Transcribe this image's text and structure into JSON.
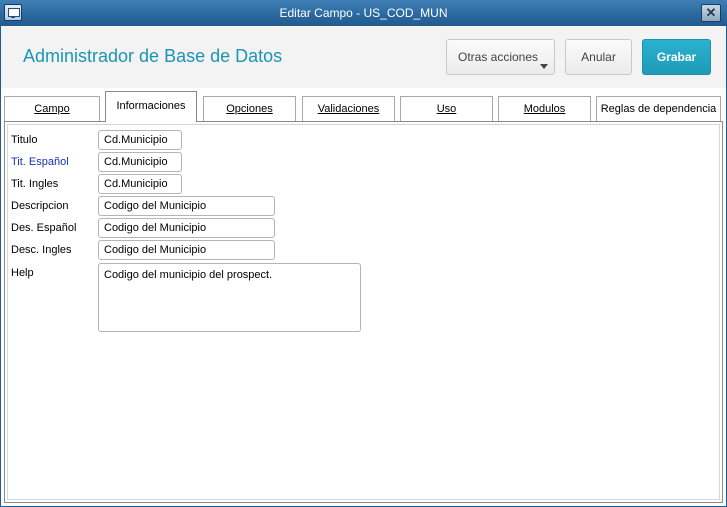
{
  "window": {
    "title": "Editar Campo - US_COD_MUN",
    "close_label": "✕",
    "colors": {
      "titlebar": "#2a679f",
      "accent": "#1c94b3",
      "primary_button": "#22a4c2",
      "blue_label": "#1a2fb3"
    }
  },
  "header": {
    "app_title": "Administrador de Base de Datos",
    "more_actions_label": "Otras acciones",
    "cancel_label": "Anular",
    "save_label": "Grabar"
  },
  "tabs": [
    {
      "label": "Campo",
      "active": false
    },
    {
      "label": "Informaciones",
      "active": true
    },
    {
      "label": "Opciones",
      "active": false
    },
    {
      "label": "Validaciones",
      "active": false
    },
    {
      "label": "Uso",
      "active": false
    },
    {
      "label": "Modulos",
      "active": false
    },
    {
      "label": "Reglas de dependencia",
      "active": false
    }
  ],
  "form": {
    "titulo": {
      "label": "Titulo",
      "value": "Cd.Municipio"
    },
    "tit_espanol": {
      "label": "Tit. Español",
      "value": "Cd.Municipio"
    },
    "tit_ingles": {
      "label": "Tit. Ingles",
      "value": "Cd.Municipio"
    },
    "descripcion": {
      "label": "Descripcion",
      "value": "Codigo del Municipio"
    },
    "des_espanol": {
      "label": "Des. Español",
      "value": "Codigo del Municipio"
    },
    "desc_ingles": {
      "label": "Desc. Ingles",
      "value": "Codigo del Municipio"
    },
    "help": {
      "label": "Help",
      "value": "Codigo del municipio del prospect."
    }
  },
  "icons": {
    "app": "window-app-icon",
    "close": "close-icon",
    "dropdown": "chevron-down-icon"
  }
}
